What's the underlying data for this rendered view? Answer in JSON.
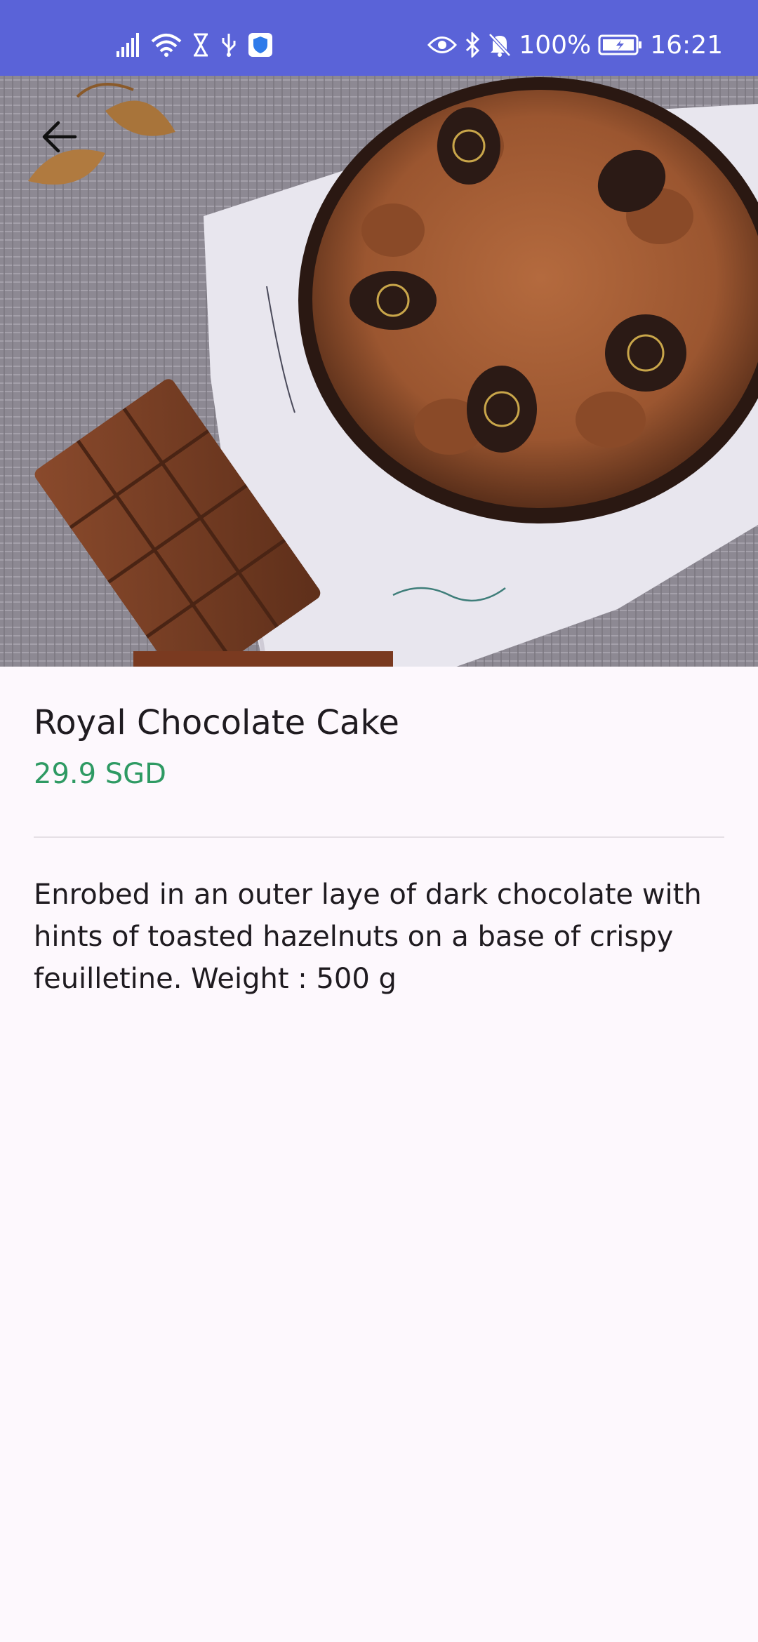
{
  "status_bar": {
    "battery": "100%",
    "time": "16:21",
    "bg_color": "#5a63d8",
    "left_icons": [
      "signal-icon",
      "wifi-icon",
      "hourglass-icon",
      "usb-icon",
      "shield-icon"
    ],
    "right_icons": [
      "eye-icon",
      "bluetooth-icon",
      "bell-off-icon",
      "battery-icon"
    ]
  },
  "product": {
    "title": "Royal Chocolate Cake",
    "price": "29.9 SGD",
    "price_color": "#2e9a63",
    "description": "Enrobed in an outer laye of dark chocolate with hints of toasted hazelnuts on a base of crispy feuilletine. Weight : 500 g"
  },
  "nav": {
    "back_icon": "arrow-left-icon"
  }
}
